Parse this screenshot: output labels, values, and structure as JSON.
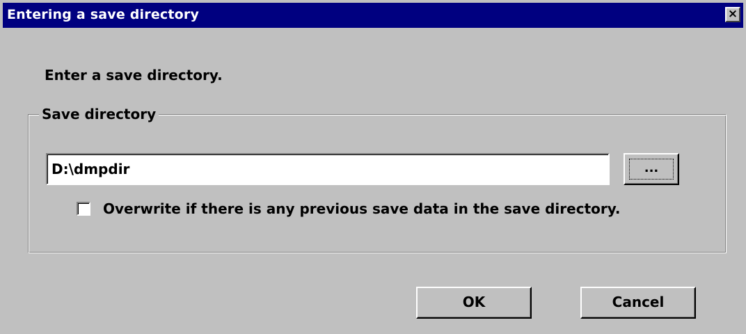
{
  "window": {
    "title": "Entering a save directory",
    "close_glyph": "×"
  },
  "prompt": "Enter a save directory.",
  "save_directory_group": {
    "legend": "Save directory",
    "path_value": "D:\\dmpdir",
    "browse_label": "...",
    "overwrite_checkbox": {
      "checked": false,
      "label": "Overwrite if there is any previous save data  in the save directory."
    }
  },
  "buttons": {
    "ok_label": "OK",
    "cancel_label": "Cancel"
  }
}
